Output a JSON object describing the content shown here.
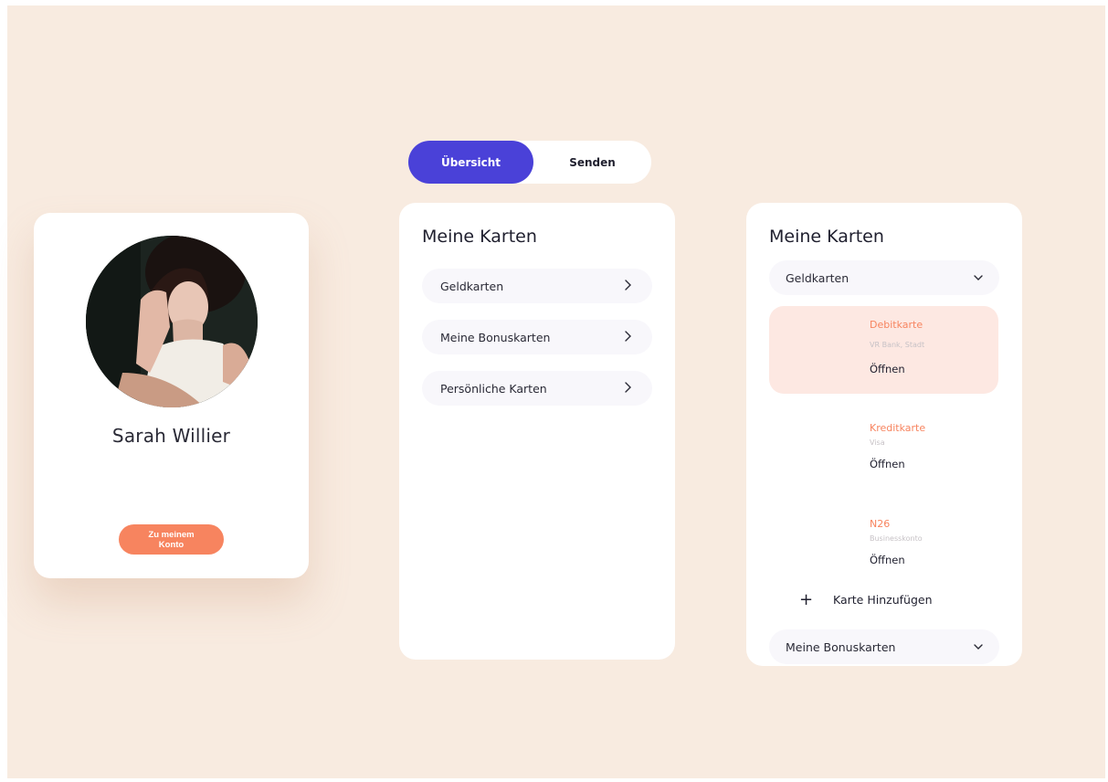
{
  "profile": {
    "name": "Sarah Willier",
    "button_label": "Zu meinem\nKonto"
  },
  "tabs": {
    "active": "Übersicht",
    "inactive": "Senden"
  },
  "cards_panel": {
    "title": "Meine Karten",
    "items": [
      {
        "label": "Geldkarten"
      },
      {
        "label": "Meine Bonuskarten"
      },
      {
        "label": "Persönliche Karten"
      }
    ]
  },
  "detail_panel": {
    "title": "Meine Karten",
    "expanded_section": "Geldkarten",
    "accounts": [
      {
        "name": "Debitkarte",
        "subtitle": "VR Bank, Stadt",
        "action": "Öffnen",
        "highlighted": true
      },
      {
        "name": "Kreditkarte",
        "subtitle": "Visa",
        "action": "Öffnen",
        "highlighted": false
      },
      {
        "name": "N26",
        "subtitle": "Businesskonto",
        "action": "Öffnen",
        "highlighted": false
      }
    ],
    "add_label": "Karte Hinzufügen",
    "collapsed_section": "Meine Bonuskarten"
  },
  "colors": {
    "background": "#f8ebe0",
    "accent_blue": "#4a41d8",
    "accent_orange": "#f7845f",
    "highlight_pink": "#fde8e2"
  },
  "icons": {
    "chevron_right": "chevron-right-icon",
    "chevron_down": "chevron-down-icon",
    "plus": "plus-icon"
  }
}
